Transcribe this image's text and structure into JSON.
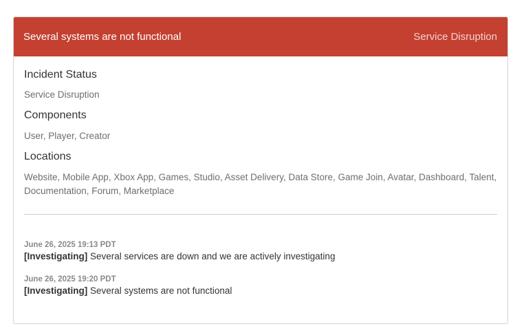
{
  "header": {
    "title": "Several systems are not functional",
    "status": "Service Disruption",
    "color": "#c44031"
  },
  "sections": [
    {
      "heading": "Incident Status",
      "value": "Service Disruption"
    },
    {
      "heading": "Components",
      "value": "User, Player, Creator"
    },
    {
      "heading": "Locations",
      "value": "Website, Mobile App, Xbox App, Games, Studio, Asset Delivery, Data Store, Game Join, Avatar, Dashboard, Talent, Documentation, Forum, Marketplace"
    }
  ],
  "updates": [
    {
      "timestamp": "June 26, 2025 19:13 PDT",
      "tag": "[Investigating]",
      "text": " Several services are down and we are actively investigating"
    },
    {
      "timestamp": "June 26, 2025 19:20 PDT",
      "tag": "[Investigating]",
      "text": " Several systems are not functional"
    }
  ]
}
